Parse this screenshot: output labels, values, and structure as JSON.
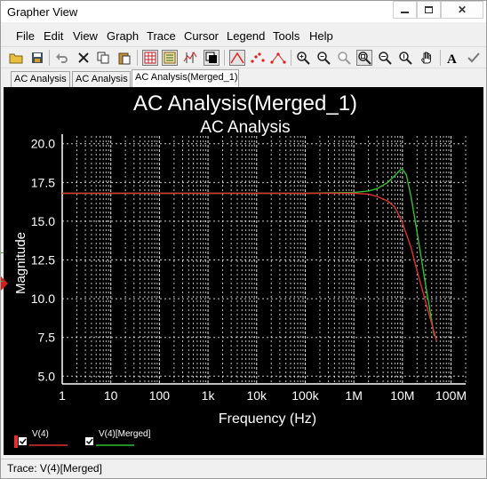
{
  "window": {
    "title": "Grapher View"
  },
  "menu": [
    "File",
    "Edit",
    "View",
    "Graph",
    "Trace",
    "Cursor",
    "Legend",
    "Tools",
    "Help"
  ],
  "toolbar_icons": [
    "open-folder-icon",
    "save-icon",
    "undo-icon",
    "delete-icon",
    "copy-icon",
    "paste-icon",
    "grid-icon",
    "legend-icon",
    "cursor-icon",
    "reverse-colors-icon",
    "lines-icon",
    "symbols-icon",
    "lines-symbols-icon",
    "zoom-in-icon",
    "zoom-out-icon",
    "zoom-area-icon",
    "zoom-full-icon",
    "zoom-x-icon",
    "zoom-y-icon",
    "pan-hand-icon",
    "text-icon",
    "check-icon"
  ],
  "tabs": [
    "AC Analysis",
    "AC Analysis",
    "AC Analysis(Merged_1)"
  ],
  "active_tab": 2,
  "status": {
    "text": "Trace: V(4)[Merged]"
  },
  "colors": {
    "background": "#000000",
    "grid": "#ffffff",
    "trace1": "#e03030",
    "trace2": "#30c030",
    "text": "#ffffff"
  },
  "chart_data": {
    "type": "line",
    "title": "AC Analysis(Merged_1)",
    "subtitle": "AC Analysis",
    "xlabel": "Frequency (Hz)",
    "ylabel": "Magnitude",
    "x_scale": "log",
    "xlim": [
      1,
      200000000
    ],
    "ylim": [
      4.5,
      20.5
    ],
    "x_ticks": [
      1,
      10,
      100,
      1000,
      10000,
      100000,
      1000000,
      10000000,
      100000000
    ],
    "x_tick_labels": [
      "1",
      "10",
      "100",
      "1k",
      "10k",
      "100k",
      "1M",
      "10M",
      "100M"
    ],
    "y_ticks": [
      5,
      7.5,
      10,
      12.5,
      15,
      17.5,
      20
    ],
    "y_tick_labels": [
      "5.0",
      "7.5",
      "10.0",
      "12.5",
      "15.0",
      "17.5",
      "20.0"
    ],
    "grid": true,
    "legend_position": "bottom-left",
    "series": [
      {
        "name": "V(4)",
        "color": "#e03030",
        "x": [
          1,
          100000,
          1000000,
          2000000,
          3000000,
          5000000,
          7000000,
          10000000,
          15000000,
          20000000,
          30000000,
          50000000
        ],
        "y": [
          16.8,
          16.8,
          16.8,
          16.75,
          16.6,
          16.3,
          15.9,
          14.9,
          13.3,
          11.8,
          9.8,
          7.3
        ]
      },
      {
        "name": "V(4)[Merged]",
        "color": "#30c030",
        "x": [
          1,
          100000,
          1000000,
          2000000,
          3000000,
          5000000,
          7000000,
          9000000,
          10000000,
          12000000,
          15000000,
          20000000,
          30000000,
          45000000
        ],
        "y": [
          16.8,
          16.8,
          16.85,
          16.95,
          17.1,
          17.5,
          17.95,
          18.3,
          18.35,
          18.0,
          16.6,
          14.3,
          10.9,
          7.6
        ]
      }
    ]
  }
}
